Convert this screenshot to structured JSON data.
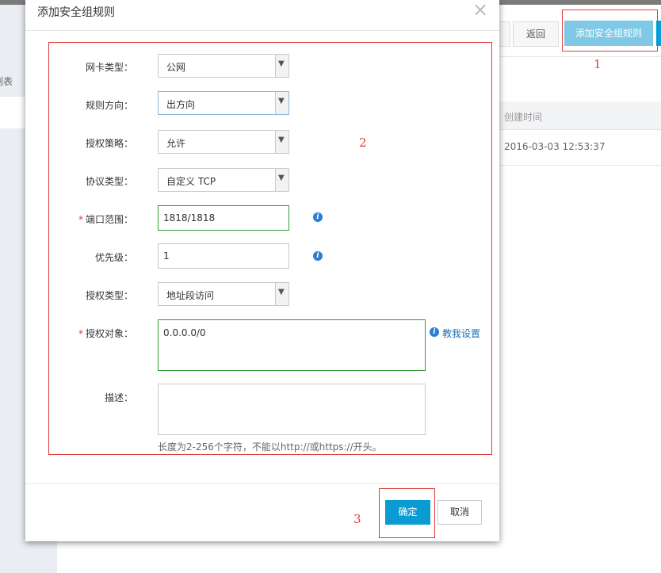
{
  "background": {
    "nav_label": "列表",
    "back_button": "返回",
    "add_rule_button": "添加安全组规则",
    "table": {
      "column_header": "创建时间",
      "cell_value": "2016-03-03 12:53:37"
    }
  },
  "annotations": {
    "label_1": "1",
    "label_2": "2",
    "label_3": "3"
  },
  "dialog": {
    "title": "添加安全组规则",
    "close_glyph": "×",
    "form": {
      "nic_type": {
        "label": "网卡类型：",
        "value": "公网"
      },
      "rule_direction": {
        "label": "规则方向：",
        "value": "出方向"
      },
      "auth_policy": {
        "label": "授权策略：",
        "value": "允许"
      },
      "protocol_type": {
        "label": "协议类型：",
        "value": "自定义 TCP"
      },
      "port_range": {
        "label": "端口范围：",
        "value": "1818/1818",
        "required_mark": "*"
      },
      "priority": {
        "label": "优先级：",
        "value": "1"
      },
      "auth_type": {
        "label": "授权类型：",
        "value": "地址段访问"
      },
      "auth_object": {
        "label": "授权对象：",
        "value": "0.0.0.0/0",
        "required_mark": "*",
        "help_link": "教我设置"
      },
      "description": {
        "label": "描述：",
        "value": "",
        "hint": "长度为2-256个字符，不能以http://或https://开头。"
      }
    },
    "info_glyph": "i",
    "select_arrow_glyph": "▼",
    "buttons": {
      "confirm": "确定",
      "cancel": "取消"
    }
  },
  "colors": {
    "annotation_red": "#e03a3a",
    "primary_blue": "#0a9bd3",
    "valid_green": "#3a9a3a",
    "info_blue": "#2a7fd4"
  }
}
